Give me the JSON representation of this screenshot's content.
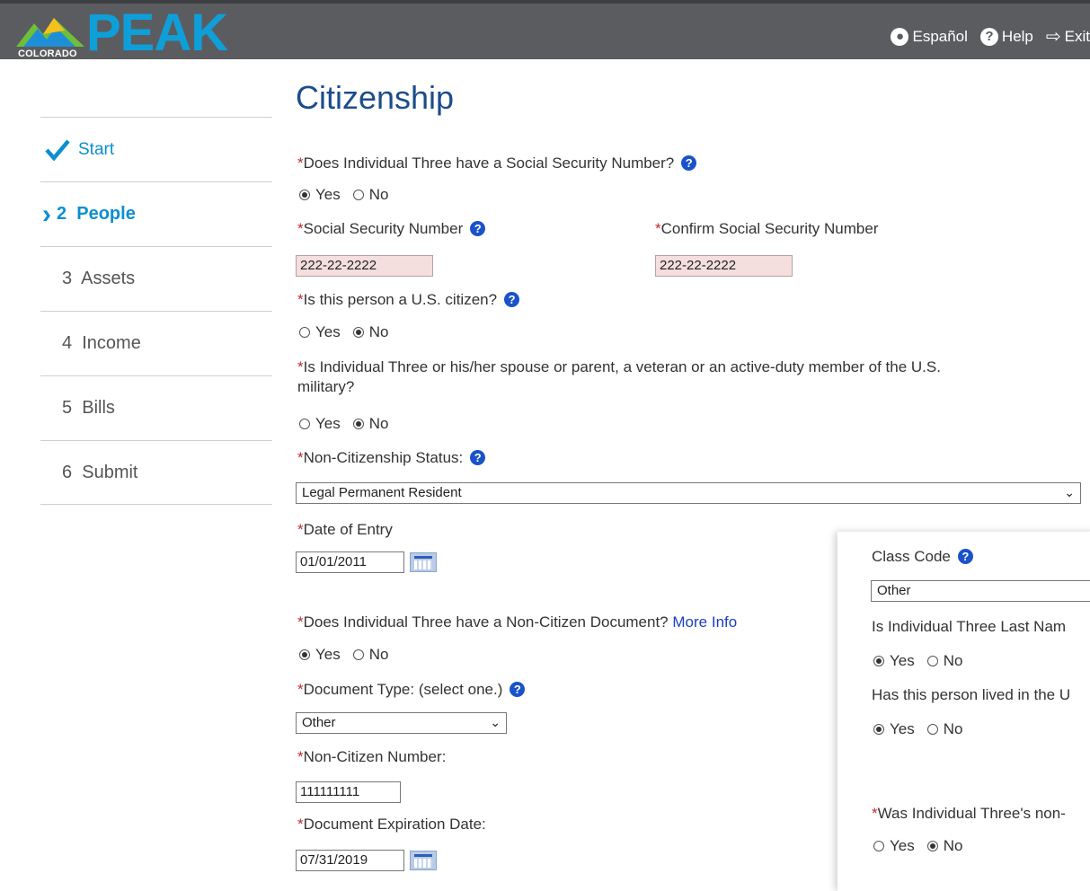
{
  "header": {
    "logo_state": "COLORADO",
    "logo_name": "PEAK",
    "links": [
      {
        "icon": "globe-icon",
        "label": "Español"
      },
      {
        "icon": "help-icon",
        "label": "Help"
      },
      {
        "icon": "exit-icon",
        "label": "Exit"
      }
    ]
  },
  "sidebar": {
    "items": [
      {
        "label": "Start",
        "state": "done"
      },
      {
        "label": "2  People",
        "state": "current"
      },
      {
        "label": "3  Assets",
        "state": "pending"
      },
      {
        "label": "4  Income",
        "state": "pending"
      },
      {
        "label": "5  Bills",
        "state": "pending"
      },
      {
        "label": "6  Submit",
        "state": "pending"
      }
    ]
  },
  "page": {
    "title": "Citizenship",
    "q_ssn": "Does Individual Three have a Social Security Number?",
    "yes": "Yes",
    "no": "No",
    "ssn_label": "Social Security Number",
    "ssn_value": "222-22-2222",
    "confirm_ssn_label": "Confirm Social Security Number",
    "confirm_ssn_value": "222-22-2222",
    "q_citizen": "Is this person a U.S. citizen?",
    "q_veteran_line1": "Is Individual Three or his/her spouse or parent, a veteran or an active-duty member of the U.S.",
    "q_veteran_line2": "military?",
    "non_citizen_status_label": "Non-Citizenship Status:",
    "non_citizen_status_value": "Legal Permanent Resident",
    "date_entry_label": "Date of Entry",
    "date_entry_value": "01/01/2011",
    "q_doc": "Does Individual Three have a Non-Citizen Document?",
    "more_info": "More Info",
    "doc_type_label": "Document Type: (select one.)",
    "doc_type_value": "Other",
    "non_citizen_number_label": "Non-Citizen Number:",
    "non_citizen_number_value": "111111111",
    "doc_exp_label": "Document Expiration Date:",
    "doc_exp_value": "07/31/2019"
  },
  "panel": {
    "class_code_label": "Class Code",
    "class_code_value": "Other",
    "q_last_name": "Is Individual Three Last Nam",
    "q_lived": "Has this person lived in the U",
    "q_was": "Was Individual Three's non-"
  },
  "colors": {
    "header_bg": "#5a5c60",
    "brand_blue": "#0f9fd8",
    "title_blue": "#1b4d8a",
    "required_red": "#c0282e",
    "field_pink": "#f4dede"
  }
}
